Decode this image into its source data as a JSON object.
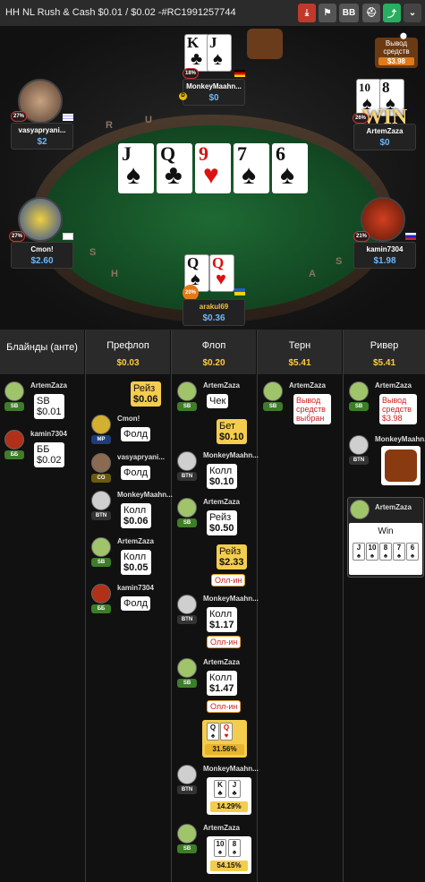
{
  "header": {
    "title": "HH NL Rush & Cash $0.01 / $0.02 -#RC1991257744",
    "buttons": [
      "download",
      "flag",
      "BB",
      "spy",
      "share",
      "chevron"
    ],
    "bb_label": "BB"
  },
  "table": {
    "rail_letters": [
      "R",
      "U",
      "S",
      "H",
      "A",
      "S"
    ],
    "board": [
      {
        "rank": "J",
        "suit": "♠",
        "red": false
      },
      {
        "rank": "Q",
        "suit": "♣",
        "red": false
      },
      {
        "rank": "9",
        "suit": "♥",
        "red": true
      },
      {
        "rank": "7",
        "suit": "♠",
        "red": false
      },
      {
        "rank": "6",
        "suit": "♠",
        "red": false
      }
    ],
    "cashout": {
      "label": "Вывод средств",
      "amount": "$3.98"
    },
    "win_label": "WIN",
    "seats": {
      "top": {
        "name": "MonkeyMaahn...",
        "stack": "$0",
        "pct": "18%",
        "cards": [
          "K♣",
          "J♠"
        ]
      },
      "left_top": {
        "name": "vasyapryani...",
        "stack": "$2",
        "pct": "27%"
      },
      "right_top": {
        "name": "ArtemZaza",
        "stack": "$0",
        "pct": "26%",
        "cards": [
          "10♠",
          "8♠"
        ]
      },
      "left_mid": {
        "name": "Cmon!",
        "stack": "$2.60",
        "pct": "27%"
      },
      "right_mid": {
        "name": "kamin7304",
        "stack": "$1.98",
        "pct": "21%"
      },
      "bottom": {
        "name": "arakul69",
        "stack": "$0.36",
        "pct": "20%",
        "cards": [
          "Q♠",
          "Q♥"
        ]
      }
    }
  },
  "history": {
    "columns": [
      {
        "name": "Блайнды (анте)",
        "value": ""
      },
      {
        "name": "Префлоп",
        "value": "$0.03"
      },
      {
        "name": "Флоп",
        "value": "$0.20"
      },
      {
        "name": "Терн",
        "value": "$5.41"
      },
      {
        "name": "Ривер",
        "value": "$5.41"
      }
    ],
    "blinds": [
      {
        "player": "ArtemZaza",
        "pos": "SB",
        "line1": "SB",
        "line2": "$0.01"
      },
      {
        "player": "kamin7304",
        "pos": "ББ",
        "line1": "ББ",
        "line2": "$0.02"
      }
    ],
    "preflop": {
      "raise_label": "Рейз",
      "raise_amount": "$0.06",
      "rows": [
        {
          "player": "Cmon!",
          "pos": "MP",
          "action": "Фолд"
        },
        {
          "player": "vasyapryani...",
          "pos": "CO",
          "action": "Фолд"
        },
        {
          "player": "MonkeyMaahn...",
          "pos": "BTN",
          "action": "Колл",
          "amount": "$0.06"
        },
        {
          "player": "ArtemZaza",
          "pos": "SB",
          "action": "Колл",
          "amount": "$0.05"
        },
        {
          "player": "kamin7304",
          "pos": "ББ",
          "action": "Фолд"
        }
      ]
    },
    "flop": {
      "rows": [
        {
          "player": "ArtemZaza",
          "pos": "SB",
          "action": "Чек"
        },
        {
          "bet_label": "Бет",
          "bet_amount": "$0.10"
        },
        {
          "player": "MonkeyMaahn...",
          "pos": "BTN",
          "action": "Колл",
          "amount": "$0.10"
        },
        {
          "player": "ArtemZaza",
          "pos": "SB",
          "action": "Рейз",
          "amount": "$0.50"
        },
        {
          "raise_label": "Рейз",
          "raise_amount": "$2.33",
          "allin": "Олл-ин"
        },
        {
          "player": "MonkeyMaahn...",
          "pos": "BTN",
          "action": "Колл",
          "amount": "$1.17",
          "allin": "Олл-ин"
        },
        {
          "player": "ArtemZaza",
          "pos": "SB",
          "action": "Колл",
          "amount": "$1.47",
          "allin": "Олл-ин"
        }
      ],
      "hero_equity": {
        "cards": [
          "Q♠",
          "Q♥"
        ],
        "pct": "31.56%"
      },
      "monkey_equity": {
        "player": "MonkeyMaahn...",
        "pos": "BTN",
        "cards": [
          "K♣",
          "J♣"
        ],
        "pct": "14.29%"
      },
      "artem_equity": {
        "player": "ArtemZaza",
        "pos": "SB",
        "cards": [
          "10♠",
          "8♠"
        ],
        "pct": "54.15%"
      }
    },
    "turn": {
      "player": "ArtemZaza",
      "pos": "SB",
      "text": "Вывод средств выбран"
    },
    "river": {
      "cashout": {
        "player": "ArtemZaza",
        "pos": "SB",
        "text": "Вывод средств",
        "amount": "$3.98"
      },
      "monkey": {
        "player": "MonkeyMaahn...",
        "pos": "BTN"
      },
      "winner": {
        "player": "ArtemZaza",
        "label": "Win",
        "cards": [
          "J♠",
          "10♠",
          "8♠",
          "7♠",
          "6♠"
        ]
      }
    }
  }
}
